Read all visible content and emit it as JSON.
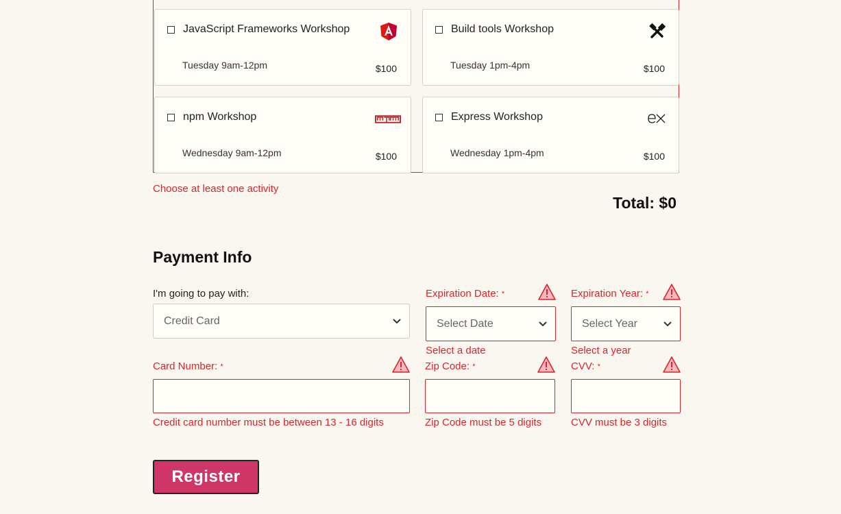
{
  "activities": [
    {
      "title": "JavaScript Frameworks Workshop",
      "when": "Tuesday 9am-12pm",
      "price": "$100",
      "icon": "angular-logo-icon"
    },
    {
      "title": "Build tools Workshop",
      "when": "Tuesday 1pm-4pm",
      "price": "$100",
      "icon": "build-tools-icon"
    },
    {
      "title": "npm Workshop",
      "when": "Wednesday 9am-12pm",
      "price": "$100",
      "icon": "npm-logo-icon"
    },
    {
      "title": "Express Workshop",
      "when": "Wednesday 1pm-4pm",
      "price": "$100",
      "icon": "express-logo-icon"
    }
  ],
  "activities_error": "Choose at least one activity",
  "total": "Total: $0",
  "payment": {
    "heading": "Payment Info",
    "pay_with_label": "I'm going to pay with:",
    "pay_with_value": "Credit Card",
    "exp_date_label": "Expiration Date:",
    "exp_date_placeholder": "Select Date",
    "exp_date_error": "Select a date",
    "exp_year_label": "Expiration Year:",
    "exp_year_placeholder": "Select Year",
    "exp_year_error": "Select a year",
    "card_label": "Card Number:",
    "card_value": "",
    "card_error": "Credit card number must be between 13 - 16 digits",
    "zip_label": "Zip Code:",
    "zip_value": "",
    "zip_error": "Zip Code must be 5 digits",
    "cvv_label": "CVV:",
    "cvv_value": "",
    "cvv_error": "CVV must be 3 digits",
    "required_marker": "*"
  },
  "register_label": "Register",
  "colors": {
    "error": "#d8262b",
    "button": "#cf3566",
    "background": "#faf6f0"
  }
}
